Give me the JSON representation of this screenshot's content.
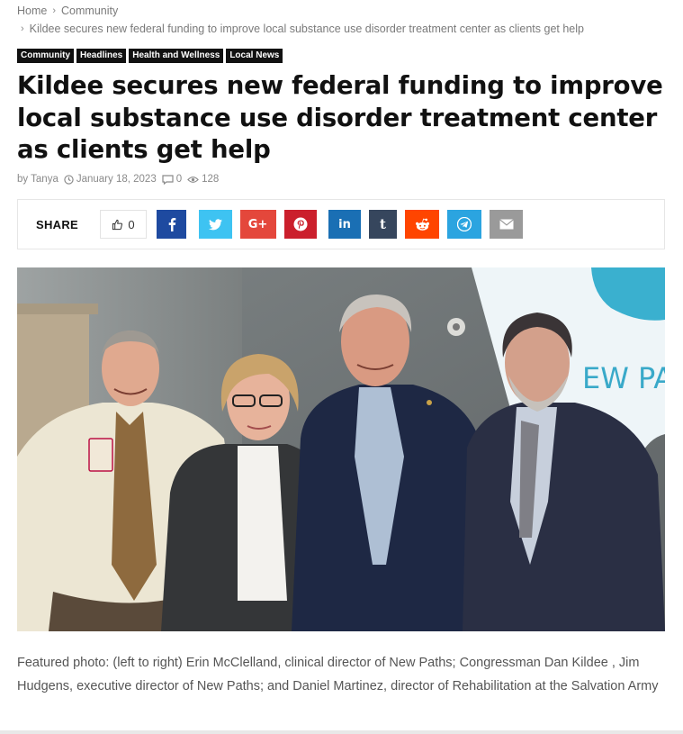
{
  "breadcrumb": {
    "home": "Home",
    "section": "Community",
    "current": "Kildee secures new federal funding to improve local substance use disorder treatment center as clients get help"
  },
  "categories": [
    "Community",
    "Headlines",
    "Health and Wellness",
    "Local News"
  ],
  "article": {
    "title": "Kildee secures new federal funding to improve local substance use disorder treatment center as clients get help",
    "author_prefix": "by",
    "author": "Tanya",
    "date": "January 18, 2023",
    "comments": "0",
    "views": "128"
  },
  "share": {
    "label": "SHARE",
    "likes": "0",
    "buttons": [
      {
        "icon": "facebook-icon",
        "glyph": "f",
        "color": "#1e4aa0"
      },
      {
        "icon": "twitter-icon",
        "glyph": "",
        "color": "#3ec3f2"
      },
      {
        "icon": "google-plus-icon",
        "glyph": "G+",
        "color": "#e4473b"
      },
      {
        "icon": "pinterest-icon",
        "glyph": "",
        "color": "#cb1f2c"
      },
      {
        "icon": "linkedin-icon",
        "glyph": "in",
        "color": "#1a6fb4"
      },
      {
        "icon": "tumblr-icon",
        "glyph": "t",
        "color": "#36465d"
      },
      {
        "icon": "reddit-icon",
        "glyph": "",
        "color": "#ff4500"
      },
      {
        "icon": "telegram-icon",
        "glyph": "",
        "color": "#2ba4e0"
      },
      {
        "icon": "email-icon",
        "glyph": "",
        "color": "#9a9a9a"
      }
    ]
  },
  "photo": {
    "sign_text": "EW PA"
  },
  "caption": "Featured photo: (left to right) Erin McClelland, clinical director of New Paths; Congressman Dan Kildee , Jim Hudgens, executive director of New Paths; and Daniel Martinez, director of Rehabilitation at the Salvation Army"
}
